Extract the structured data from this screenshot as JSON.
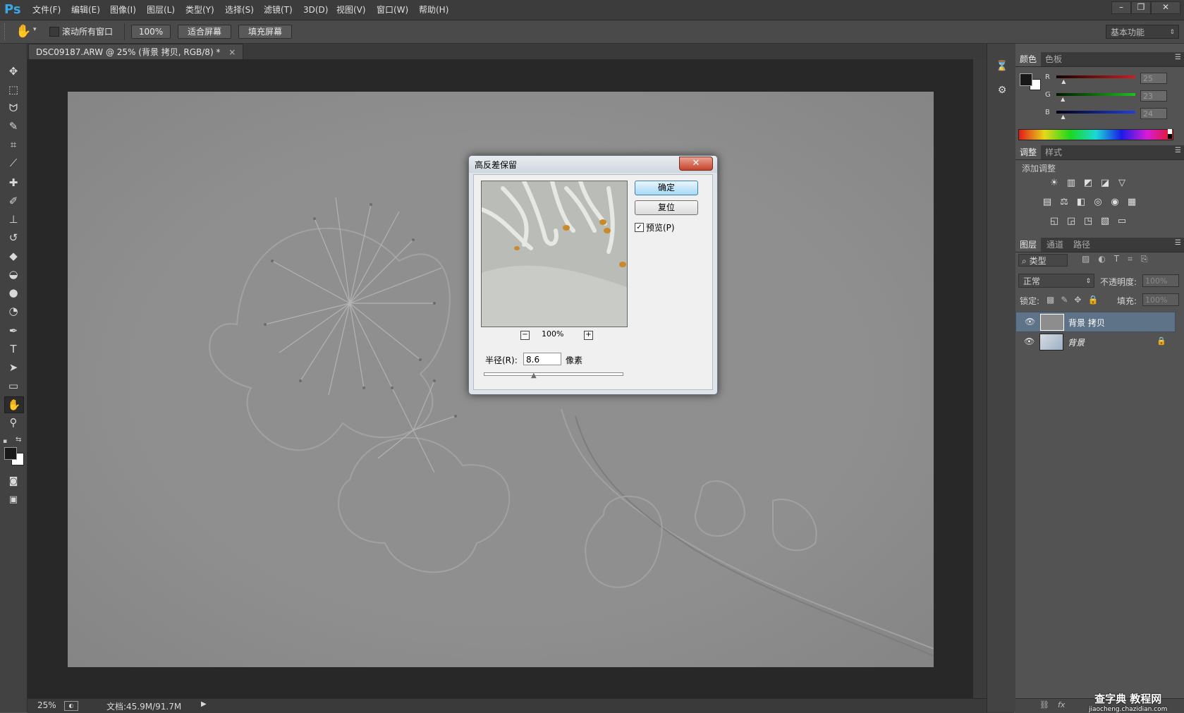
{
  "app": {
    "logo": "Ps"
  },
  "menu": [
    "文件(F)",
    "编辑(E)",
    "图像(I)",
    "图层(L)",
    "类型(Y)",
    "选择(S)",
    "滤镜(T)",
    "3D(D)",
    "视图(V)",
    "窗口(W)",
    "帮助(H)"
  ],
  "window_controls": {
    "minimize": "–",
    "restore": "❐",
    "close": "✕"
  },
  "options_bar": {
    "scroll_all_label": "滚动所有窗口",
    "zoom_100": "100%",
    "fit_screen": "适合屏幕",
    "fill_screen": "填充屏幕",
    "workspace": "基本功能"
  },
  "document": {
    "tab_title": "DSC09187.ARW @ 25% (背景 拷贝, RGB/8) *",
    "tab_close": "×"
  },
  "status_bar": {
    "zoom": "25%",
    "doc_info": "文档:45.9M/91.7M",
    "arrow": "▶"
  },
  "color_panel": {
    "tabs": [
      "颜色",
      "色板"
    ],
    "channels": [
      {
        "label": "R",
        "value": "25",
        "level": 0.1
      },
      {
        "label": "G",
        "value": "23",
        "level": 0.09
      },
      {
        "label": "B",
        "value": "24",
        "level": 0.094
      }
    ],
    "colors": {
      "r_track": "#cc1f1f",
      "g_track": "#1fbf1f",
      "b_track": "#1f3fdf"
    }
  },
  "adjustments_panel": {
    "tabs": [
      "调整",
      "样式"
    ],
    "heading": "添加调整",
    "icons": [
      [
        "brightness-icon",
        "levels-icon",
        "curves-icon",
        "exposure-icon",
        "vibrance-icon"
      ],
      [
        "hue-saturation-icon",
        "color-balance-icon",
        "black-white-icon",
        "photo-filter-icon",
        "channel-mixer-icon",
        "color-lookup-icon"
      ],
      [
        "invert-icon",
        "posterize-icon",
        "threshold-icon",
        "selective-color-icon",
        "gradient-map-icon"
      ]
    ],
    "glyphs": [
      [
        "☀",
        "▥",
        "◩",
        "◪",
        "▽"
      ],
      [
        "▤",
        "⚖",
        "◧",
        "◎",
        "◉",
        "▦"
      ],
      [
        "◱",
        "◲",
        "◳",
        "▧",
        "▭"
      ]
    ]
  },
  "layers_panel": {
    "tabs": [
      "图层",
      "通道",
      "路径"
    ],
    "filter_label": "类型",
    "blend_mode": "正常",
    "opacity_label": "不透明度:",
    "opacity_value": "100%",
    "lock_label": "锁定:",
    "fill_label": "填充:",
    "fill_value": "100%",
    "layers": [
      {
        "name": "背景 拷贝",
        "selected": true,
        "locked": false
      },
      {
        "name": "背景",
        "selected": false,
        "locked": true
      }
    ]
  },
  "dialog": {
    "title": "高反差保留",
    "ok": "确定",
    "reset": "复位",
    "preview_label": "预览(P)",
    "preview_checked": true,
    "zoom_level": "100%",
    "zoom_out": "−",
    "zoom_in": "+",
    "radius_label": "半径(R):",
    "radius_value": "8.6",
    "radius_unit": "像素",
    "close": "✕"
  },
  "watermark": {
    "line1": "查字典 教程网",
    "line2": "jiaocheng.chazidian.com"
  }
}
